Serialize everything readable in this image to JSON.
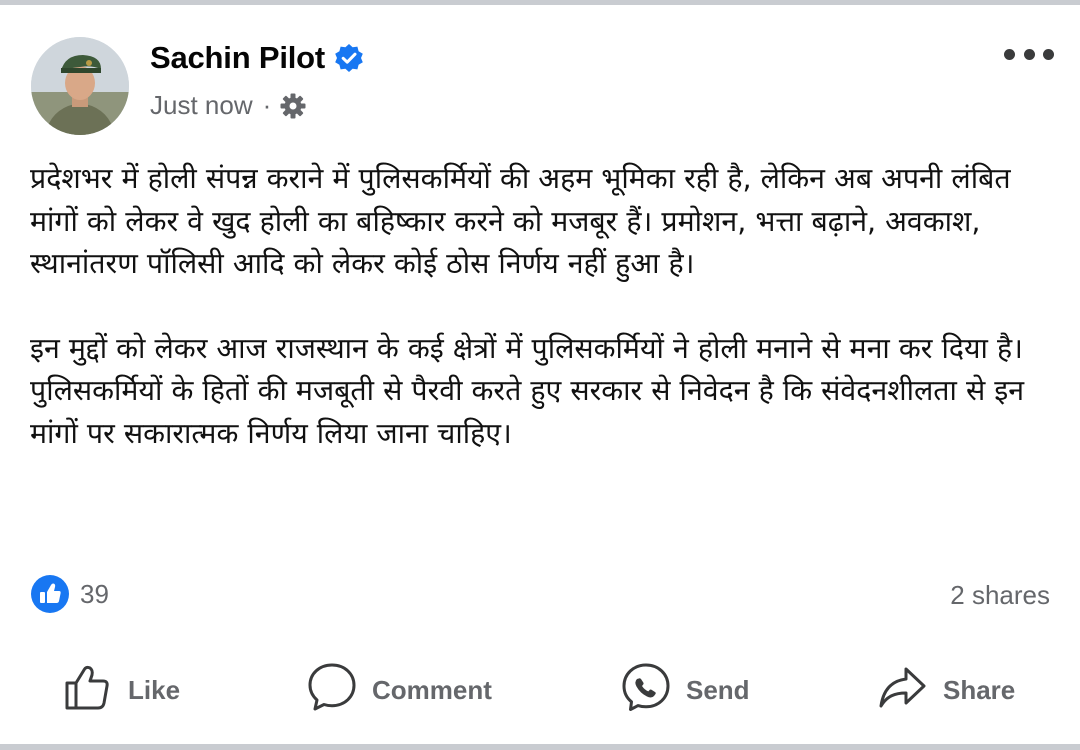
{
  "post": {
    "author_name": "Sachin Pilot",
    "timestamp": "Just now",
    "separator": "·",
    "paragraphs": [
      "प्रदेशभर में होली संपन्न कराने में पुलिसकर्मियों की अहम भूमिका रही है, लेकिन अब अपनी लंबित मांगों को लेकर वे खुद होली का बहिष्कार करने को मजबूर हैं। प्रमोशन, भत्ता बढ़ाने, अवकाश, स्थानांतरण पॉलिसी आदि को लेकर कोई ठोस निर्णय नहीं हुआ है।",
      "इन मुद्दों को लेकर आज राजस्थान के कई क्षेत्रों में पुलिसकर्मियों ने होली मनाने से मना कर दिया है। पुलिसकर्मियों के हितों की मजबूती से पैरवी करते हुए सरकार से निवेदन है कि संवेदनशीलता से इन मांगों पर सकारात्मक निर्णय लिया जाना चाहिए।"
    ]
  },
  "stats": {
    "reaction_count": "39",
    "shares": "2 shares"
  },
  "actions": {
    "like": "Like",
    "comment": "Comment",
    "send": "Send",
    "share": "Share"
  },
  "icons": {
    "verified": "verified-badge-icon",
    "privacy": "gear-icon",
    "more": "more-options-icon",
    "reaction": "like-reaction-icon",
    "like": "thumbs-up-icon",
    "comment": "comment-icon",
    "send": "messenger-icon",
    "share": "share-arrow-icon"
  },
  "colors": {
    "brand_blue": "#1877f2",
    "secondary_text": "#65676b",
    "primary_text": "#050505"
  }
}
